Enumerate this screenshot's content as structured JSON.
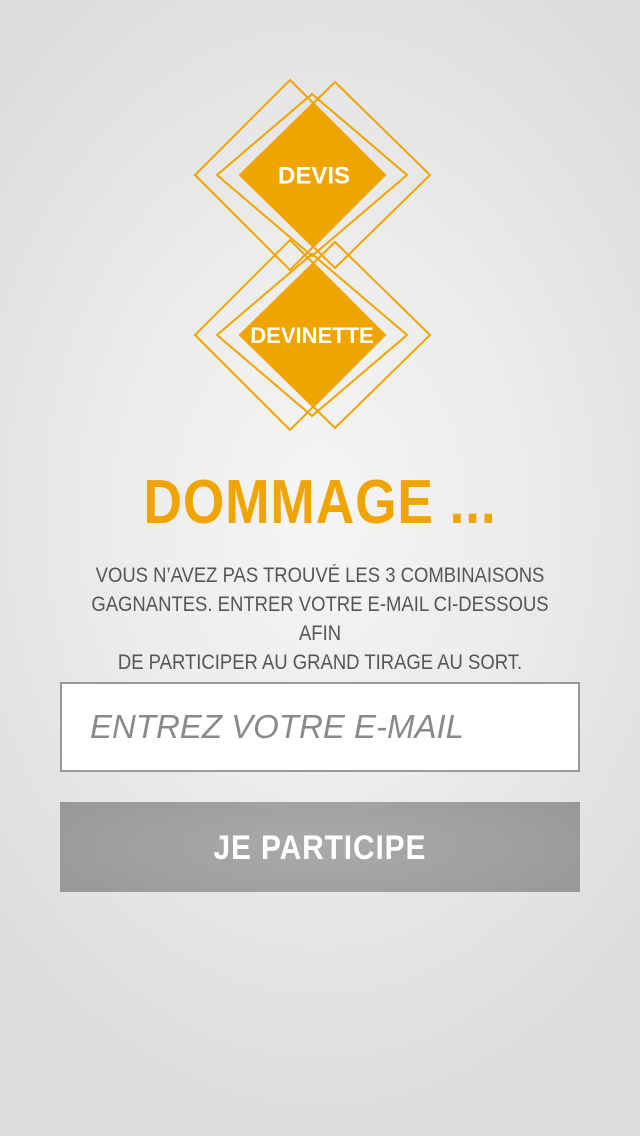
{
  "logo": {
    "top_label": "DEVIS",
    "bottom_label": "DEVINETTE",
    "accent_color": "#f0a400"
  },
  "result": {
    "title": "DOMMAGE ...",
    "message_lines": [
      "VOUS N’AVEZ PAS TROUVÉ LES 3 COMBINAISONS",
      "GAGNANTES. ENTRER VOTRE E-MAIL CI-DESSOUS AFIN",
      "DE PARTICIPER AU GRAND TIRAGE AU SORT."
    ]
  },
  "form": {
    "email_placeholder": "ENTREZ VOTRE E-MAIL",
    "email_value": "",
    "submit_label": "JE PARTICIPE"
  }
}
